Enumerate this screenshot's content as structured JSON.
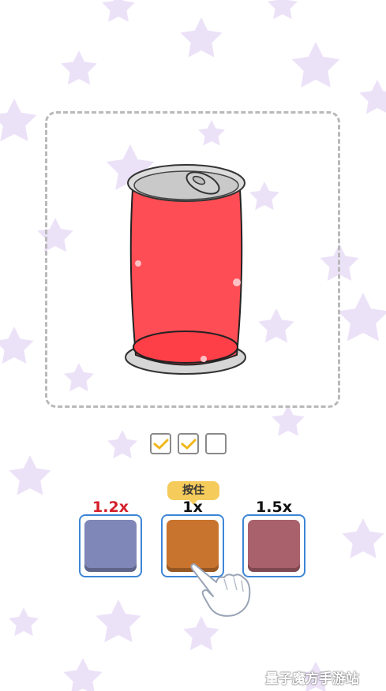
{
  "colors": {
    "star": "#ece2f8",
    "can_fill": "#ff4d55",
    "swatch_blue": "#7f86b8",
    "swatch_orange": "#c8742e",
    "swatch_rose": "#a9616c",
    "check_mark": "#f0b618",
    "multiplier_red": "#d41f2a"
  },
  "progress": {
    "total": 3,
    "completed": 2
  },
  "hint_label": "按住",
  "options": [
    {
      "multiplier": "1.2x",
      "color": "#7f86b8"
    },
    {
      "multiplier": "1x",
      "color": "#c8742e"
    },
    {
      "multiplier": "1.5x",
      "color": "#a9616c"
    }
  ],
  "watermark": {
    "text": "量子魔方手游站",
    "logo": "jiyou-logo-icon"
  }
}
